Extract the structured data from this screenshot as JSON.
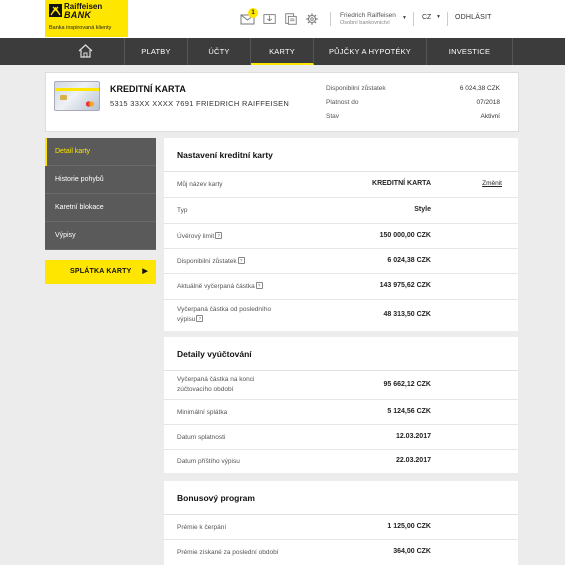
{
  "brand": {
    "name": "Raiffeisen",
    "bank": "BANK",
    "tagline": "Banka inspirovaná klienty"
  },
  "header": {
    "mail_badge": "1",
    "user_name": "Friedrich Raiffeisen",
    "user_role": "Osobní bankovnictví",
    "language": "CZ",
    "logout": "ODHLÁSIT",
    "icons": [
      "mail-icon",
      "inbox-icon",
      "document-icon",
      "gear-icon"
    ]
  },
  "nav": {
    "home_icon": "home-icon",
    "items": [
      {
        "label": "PLATBY"
      },
      {
        "label": "ÚČTY"
      },
      {
        "label": "KARTY",
        "active": true
      },
      {
        "label": "PŮJČKY A HYPOTÉKY"
      },
      {
        "label": "INVESTICE"
      }
    ]
  },
  "card": {
    "title": "KREDITNÍ KARTA",
    "number_holder": "5315 33XX XXXX 7691 FRIEDRICH RAIFFEISEN",
    "info": [
      {
        "label": "Disponibilní zůstatek",
        "value": "6 024,38 CZK"
      },
      {
        "label": "Platnost do",
        "value": "07/2018"
      },
      {
        "label": "Stav",
        "value": "Aktivní"
      }
    ]
  },
  "sidebar": {
    "items": [
      {
        "label": "Detail karty",
        "active": true
      },
      {
        "label": "Historie pohybů"
      },
      {
        "label": "Karetní blokace"
      },
      {
        "label": "Výpisy"
      }
    ],
    "repay_button": "SPLÁTKA KARTY",
    "repay_arrow": "▶"
  },
  "settings": {
    "title": "Nastavení kreditní karty",
    "rows": [
      {
        "label": "Můj název karty",
        "value": "KREDITNÍ KARTA",
        "action": "Změnit"
      },
      {
        "label": "Typ",
        "value": "Style"
      },
      {
        "label": "Úvěrový limit",
        "value": "150 000,00 CZK",
        "help": "?"
      },
      {
        "label": "Disponibilní zůstatek",
        "value": "6 024,38 CZK",
        "help": "?"
      },
      {
        "label": "Aktuálně vyčerpaná částka",
        "value": "143 975,62 CZK",
        "help": "?"
      },
      {
        "label": "Vyčerpaná částka od posledního",
        "label2": "výpisu",
        "value": "48 313,50 CZK",
        "help": "?"
      }
    ]
  },
  "billing": {
    "title": "Detaily vyúčtování",
    "rows": [
      {
        "label": "Vyčerpaná částka na konci",
        "label2": "zúčtovacího období",
        "value": "95 662,12 CZK"
      },
      {
        "label": "Minimální splátka",
        "value": "5 124,56 CZK"
      },
      {
        "label": "Datum splatnosti",
        "value": "12.03.2017"
      },
      {
        "label": "Datum příštího výpisu",
        "value": "22.03.2017"
      }
    ]
  },
  "bonus": {
    "title": "Bonusový program",
    "rows": [
      {
        "label": "Prémie k čerpání",
        "value": "1 125,00 CZK"
      },
      {
        "label": "Prémie získané za poslední období",
        "value": "364,00 CZK"
      }
    ]
  }
}
